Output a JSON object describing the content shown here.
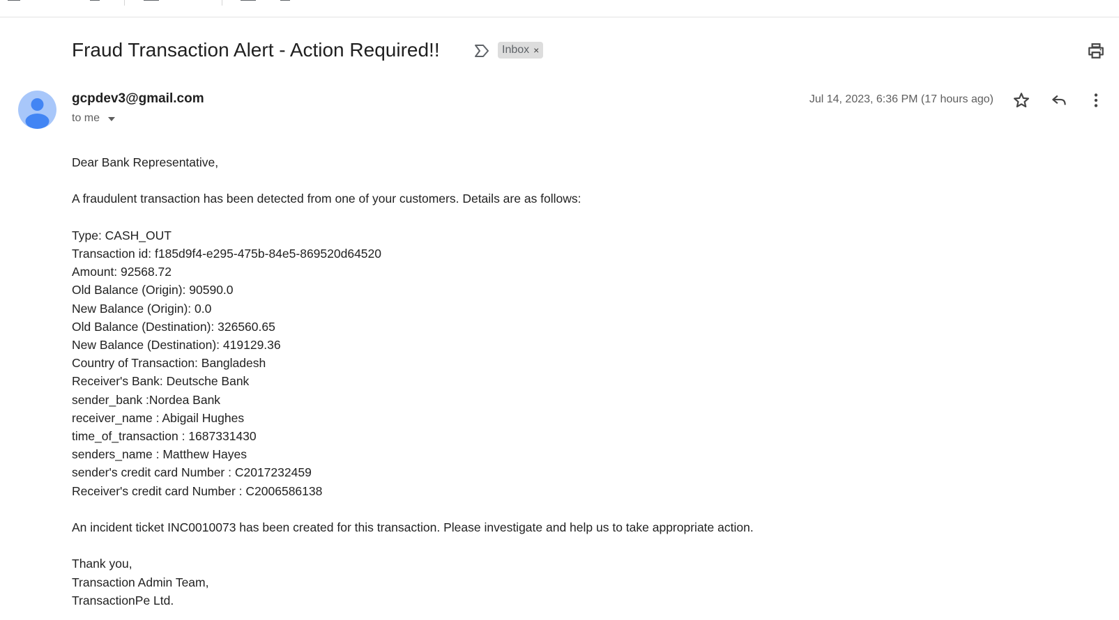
{
  "email": {
    "subject": "Fraud Transaction Alert - Action Required!!",
    "label": "Inbox",
    "label_remove": "×",
    "sender_email": "gcpdev3@gmail.com",
    "recipient": "to me",
    "date": "Jul 14, 2023, 6:36 PM (17 hours ago)"
  },
  "body": {
    "greeting": "Dear Bank Representative,",
    "intro": "A fraudulent transaction has been detected from one of your customers. Details are as follows:",
    "details": [
      "Type: CASH_OUT",
      "Transaction id: f185d9f4-e295-475b-84e5-869520d64520",
      "Amount: 92568.72",
      "Old Balance (Origin): 90590.0",
      "New Balance (Origin): 0.0",
      "Old Balance (Destination): 326560.65",
      "New Balance (Destination): 419129.36",
      "Country of Transaction: Bangladesh",
      "Receiver's Bank: Deutsche Bank",
      "sender_bank :Nordea Bank",
      "receiver_name : Abigail Hughes",
      "time_of_transaction : 1687331430",
      "senders_name : Matthew Hayes",
      "sender's credit card Number : C2017232459",
      "Receiver's credit card Number : C2006586138"
    ],
    "incident": "An incident ticket INC0010073 has been created for this transaction. Please investigate and help us to take appropriate action.",
    "signoff": [
      "Thank you,",
      "Transaction Admin Team,",
      "TransactionPe Ltd."
    ]
  },
  "icons": {
    "toolbar": [
      "archive-icon",
      "report-spam-icon",
      "delete-icon",
      "mark-unread-icon",
      "snooze-icon",
      "move-to-icon",
      "label-icon",
      "more-icon"
    ],
    "subject": [
      "important-marker-icon",
      "print-icon"
    ],
    "actions": [
      "star-icon",
      "reply-icon",
      "more-vert-icon"
    ]
  },
  "colors": {
    "avatar_bg": "#a8c7fa",
    "avatar_fg": "#4285f4",
    "label_bg": "#dddddd",
    "text": "#222222",
    "muted": "#5e5e5e"
  }
}
